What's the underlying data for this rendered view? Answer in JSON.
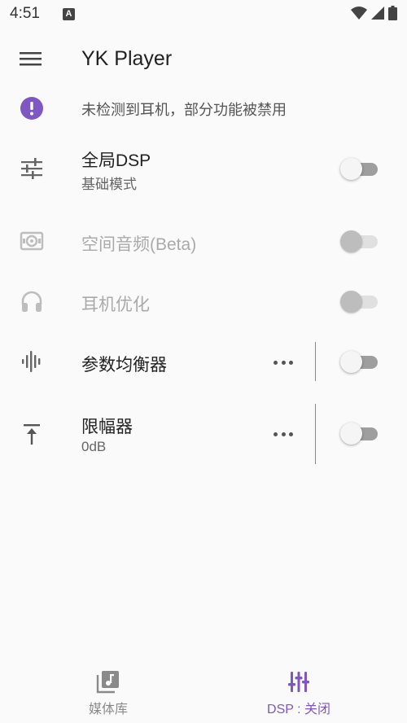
{
  "status": {
    "time": "4:51",
    "notification_glyph": "A"
  },
  "app": {
    "title": "YK Player"
  },
  "notice": {
    "text": "未检测到耳机，部分功能被禁用",
    "icon": "exclamation-circle-icon",
    "color": "#7e57c2"
  },
  "rows": [
    {
      "title": "全局DSP",
      "subtitle": "基础模式",
      "icon": "sliders-icon",
      "enabled": true,
      "switch_on": false
    },
    {
      "title": "空间音频(Beta)",
      "icon": "spatial-audio-icon",
      "enabled": false,
      "switch_on": false
    },
    {
      "title": "耳机优化",
      "icon": "headphones-icon",
      "enabled": false,
      "switch_on": false
    },
    {
      "title": "参数均衡器",
      "icon": "waveform-icon",
      "enabled": true,
      "switch_on": false,
      "has_more": true
    },
    {
      "title": "限幅器",
      "subtitle": "0dB",
      "icon": "limiter-icon",
      "enabled": true,
      "switch_on": false,
      "has_more": true
    }
  ],
  "bottom_nav": [
    {
      "label": "媒体库",
      "icon": "music-library-icon",
      "active": false
    },
    {
      "label": "DSP : 关闭",
      "icon": "equalizer-icon",
      "active": true
    }
  ],
  "colors": {
    "accent": "#7e57c2",
    "inactive_nav": "#8a8a8a"
  }
}
